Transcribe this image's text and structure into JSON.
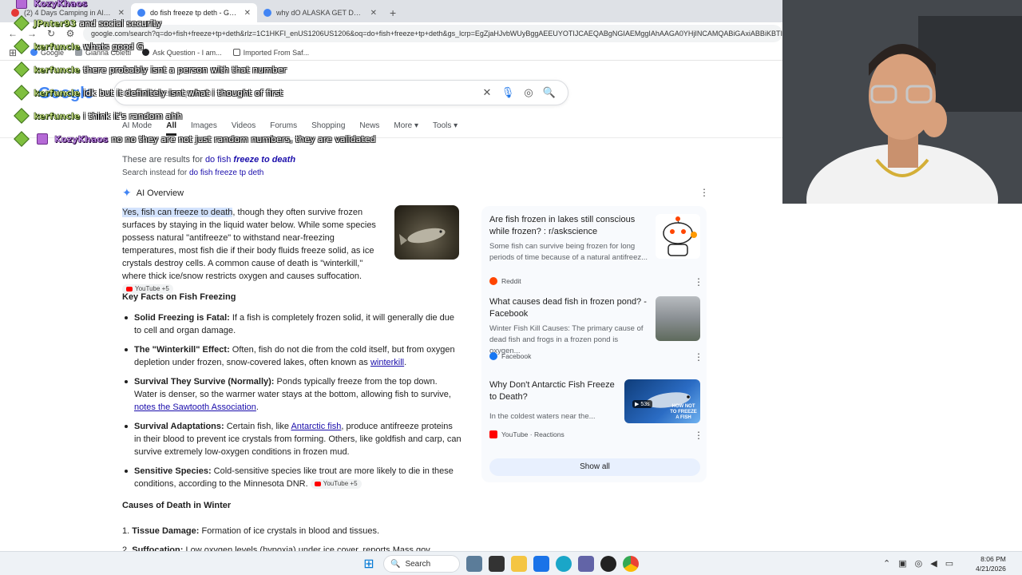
{
  "browser": {
    "tabs": [
      {
        "title": "(2) 4 Days Camping in Alaska a",
        "color": "#e53935",
        "active": false
      },
      {
        "title": "do fish freeze tp deth - Google",
        "color": "#4285f4",
        "active": true
      },
      {
        "title": "why dO ALASKA GET DARK SO",
        "color": "#4285f4",
        "active": false
      }
    ],
    "newtab": "+",
    "url": "google.com/search?q=do+fish+freeze+tp+deth&rlz=1C1HKFI_enUS1206US1206&oq=do+fish+freeze+tp+deth&gs_lcrp=EgZjaHJvbWUyBggAEEUYOTIJCAEQABgNGIAEMggIAhAAGA0YHjINCAMQABiGAxiABBiKBTI",
    "bookmarks": [
      "Google",
      "Gianna Coletti",
      "Ask Question - I am...",
      "Imported From Saf..."
    ]
  },
  "chat": [
    {
      "user": "KozyKhaos",
      "msg": "",
      "purple": true,
      "badge": "purple"
    },
    {
      "user": "JPnter93",
      "msg": "and social security",
      "purple": false,
      "badge": "green"
    },
    {
      "user": "kerfuncle",
      "msg": "whats good G",
      "purple": false,
      "badge": "green"
    },
    {
      "user": "kerfuncle",
      "msg": "there probably isnt a person with that number",
      "purple": false,
      "badge": "green"
    },
    {
      "user": "kerfuncle",
      "msg": "idk but it definitely isnt what i thought of first",
      "purple": false,
      "badge": "green"
    },
    {
      "user": "kerfuncle",
      "msg": "i think it's random ahh",
      "purple": false,
      "badge": "green"
    },
    {
      "user": "KozyKhaos",
      "msg": "no no they are not just random numbers, they are validated",
      "purple": true,
      "badge": "purple"
    }
  ],
  "google": {
    "logo": "Google",
    "query": "do fish freeze tp deth",
    "tabs": [
      "AI Mode",
      "All",
      "Images",
      "Videos",
      "Forums",
      "Shopping",
      "News",
      "More",
      "Tools"
    ],
    "active_tab": "All",
    "results_for_prefix": "These are results for",
    "results_for_plain": "do fish",
    "results_for_bold": "freeze to death",
    "search_instead_prefix": "Search instead for",
    "search_instead_query": "do fish freeze tp deth",
    "ai_overview_label": "AI Overview",
    "overview_highlight": "Yes, fish can freeze to death",
    "overview_text": ", though they often survive frozen surfaces by staying in the liquid water below. While some species possess natural \"antifreeze\" to withstand near-freezing temperatures, most fish die if their body fluids freeze solid, as ice crystals destroy cells. A common cause of death is \"winterkill,\" where thick ice/snow restricts oxygen and causes suffocation.",
    "source_chip": "YouTube +5",
    "key_facts_heading": "Key Facts on Fish Freezing",
    "facts": [
      {
        "bold": "Solid Freezing is Fatal:",
        "text": " If a fish is completely frozen solid, it will generally die due to cell and organ damage.",
        "link": "",
        "after": ""
      },
      {
        "bold": "The \"Winterkill\" Effect:",
        "text": " Often, fish do not die from the cold itself, but from oxygen depletion under frozen, snow-covered lakes, often known as ",
        "link": "winterkill",
        "after": "."
      },
      {
        "bold": "Survival They Survive (Normally):",
        "text": " Ponds typically freeze from the top down. Water is denser, so the warmer water stays at the bottom, allowing fish to survive, ",
        "link": "notes the Sawtooth Association",
        "after": "."
      },
      {
        "bold": "Survival Adaptations:",
        "text": " Certain fish, like ",
        "link": "Antarctic fish",
        "after": ", produce antifreeze proteins in their blood to prevent ice crystals from forming. Others, like goldfish and carp, can survive extremely low-oxygen conditions in frozen mud."
      },
      {
        "bold": "Sensitive Species:",
        "text": " Cold-sensitive species like trout are more likely to die in these conditions, according to the Minnesota DNR.",
        "link": "",
        "after": ""
      }
    ],
    "causes_heading": "Causes of Death in Winter",
    "causes": [
      {
        "num": "1.",
        "bold": "Tissue Damage:",
        "text": " Formation of ice crystals in blood and tissues."
      },
      {
        "num": "2.",
        "bold": "Suffocation:",
        "text": " Low oxygen levels (hypoxia) under ice cover, reports Mass.gov."
      }
    ],
    "cards": [
      {
        "title": "Are fish frozen in lakes still conscious while frozen? : r/askscience",
        "snippet": "Some fish can survive being frozen for long periods of time because of a natural antifreez...",
        "site": "Reddit",
        "site_color": "#ff4500"
      },
      {
        "title": "What causes dead fish in frozen pond? - Facebook",
        "snippet": "Winter Fish Kill Causes: The primary cause of dead fish and frogs in a frozen pond is oxygen...",
        "site": "Facebook",
        "site_color": "#1877f2"
      },
      {
        "title": "Why Don't Antarctic Fish Freeze to Death?",
        "snippet": "In the coldest waters near the...",
        "site": "YouTube · Reactions",
        "site_color": "#ff0000",
        "duration": "53s",
        "thumb_caption": "HOW NOT TO FREEZE A FISH"
      }
    ],
    "show_all": "Show all"
  },
  "taskbar": {
    "search": "Search",
    "time": "8:06 PM",
    "date": "4/21/2026"
  }
}
